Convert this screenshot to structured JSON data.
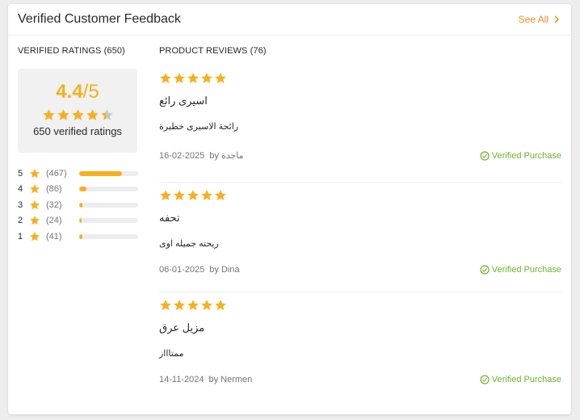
{
  "header": {
    "title": "Verified Customer Feedback",
    "see_all": "See All"
  },
  "ratings": {
    "label": "VERIFIED RATINGS (650)",
    "average": "4.4",
    "out_of": "/5",
    "average_stars": 4.4,
    "caption": "650 verified ratings",
    "breakdown": [
      {
        "stars": "5",
        "count": "(467)",
        "fraction": 0.72
      },
      {
        "stars": "4",
        "count": "(86)",
        "fraction": 0.13
      },
      {
        "stars": "3",
        "count": "(32)",
        "fraction": 0.05
      },
      {
        "stars": "2",
        "count": "(24)",
        "fraction": 0.04
      },
      {
        "stars": "1",
        "count": "(41)",
        "fraction": 0.06
      }
    ]
  },
  "reviews": {
    "label": "PRODUCT REVIEWS (76)",
    "items": [
      {
        "rating": 5,
        "title": "اسيرى رائع",
        "body": "رائحة الاسيرى خطيرة",
        "date": "16-02-2025",
        "author": "by ماجدة",
        "badge": "Verified Purchase"
      },
      {
        "rating": 5,
        "title": "تحفه",
        "body": "ريحته جميله اوى",
        "date": "06-01-2025",
        "author": "by Dina",
        "badge": "Verified Purchase"
      },
      {
        "rating": 5,
        "title": "مزيل عرق",
        "body": "ممتاااز",
        "date": "14-11-2024",
        "author": "by Nermen",
        "badge": "Verified Purchase"
      }
    ]
  },
  "colors": {
    "accent": "#f68b1e",
    "star": "#f6b01e",
    "star_empty": "#c7c7cd",
    "verified": "#6bb42e"
  },
  "icons": {
    "star": "star-icon",
    "chevron": "chevron-right-icon",
    "verified": "check-circle-icon"
  }
}
